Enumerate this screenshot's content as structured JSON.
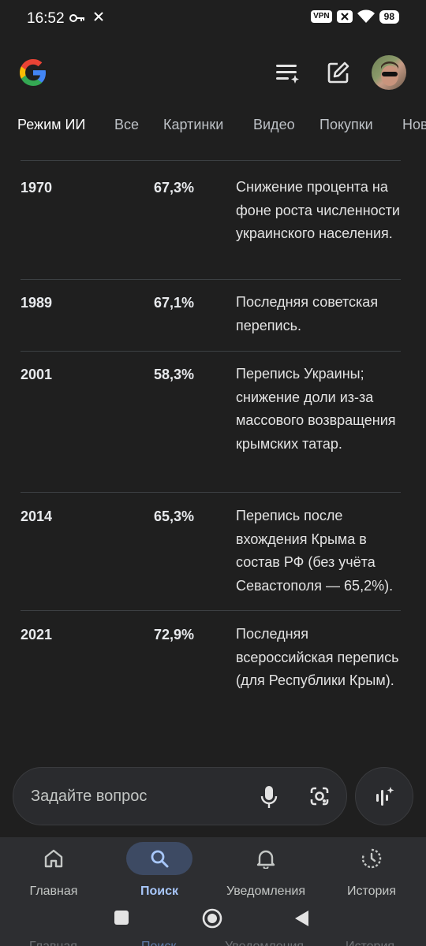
{
  "status_bar": {
    "time": "16:52",
    "vpn": "VPN",
    "battery": "98"
  },
  "header": {
    "logo": "google-g-logo",
    "icons": [
      "ai-list-icon",
      "edit-icon",
      "avatar"
    ]
  },
  "tabs": [
    "Режим ИИ",
    "Все",
    "Картинки",
    "Видео",
    "Покупки",
    "Нов"
  ],
  "table": {
    "rows": [
      {
        "year": "1970",
        "percent": "67,3%",
        "note": "Снижение процента на фоне роста численности украинского населения."
      },
      {
        "year": "1989",
        "percent": "67,1%",
        "note": "Последняя советская перепись."
      },
      {
        "year": "2001",
        "percent": "58,3%",
        "note": "Перепись Украины; снижение доли из-за массового возвращения крымских татар."
      },
      {
        "year": "2014",
        "percent": "65,3%",
        "note": "Перепись после вхождения Крыма в состав РФ (без учёта Севастополя — 65,2%)."
      },
      {
        "year": "2021",
        "percent": "72,9%",
        "note": "Последняя всероссийская перепись (для Республики Крым)."
      }
    ]
  },
  "ask": {
    "placeholder": "Задайте вопрос"
  },
  "bottom_nav": {
    "items": [
      {
        "label": "Главная",
        "icon": "home-icon"
      },
      {
        "label": "Поиск",
        "icon": "search-icon",
        "active": true
      },
      {
        "label": "Уведомления",
        "icon": "bell-icon"
      },
      {
        "label": "История",
        "icon": "history-icon"
      }
    ]
  },
  "colors": {
    "background": "#1f1f1f",
    "nav_active": "#a8c7fa",
    "nav_pill": "#3d4a63"
  }
}
